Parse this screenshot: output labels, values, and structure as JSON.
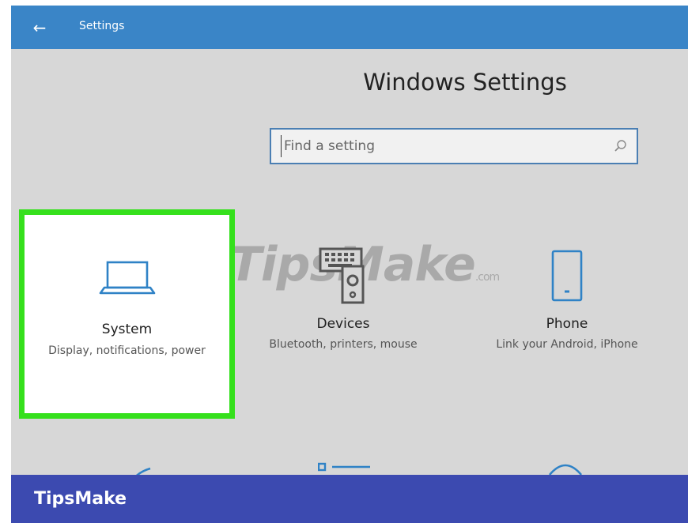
{
  "window": {
    "back_symbol": "←",
    "title": "Settings"
  },
  "heading": "Windows Settings",
  "search": {
    "placeholder": "Find a setting",
    "value": ""
  },
  "tiles": [
    {
      "name": "System",
      "description": "Display, notifications, power",
      "icon": "laptop-icon",
      "highlighted": true
    },
    {
      "name": "Devices",
      "description": "Bluetooth, printers, mouse",
      "icon": "devices-icon"
    },
    {
      "name": "Phone",
      "description": "Link your Android, iPhone",
      "icon": "phone-icon"
    }
  ],
  "watermark": {
    "text": "TipsMake",
    "suffix": ".com"
  },
  "banner": {
    "brand": "TipsMake"
  },
  "colors": {
    "titlebar": "#3a85c7",
    "accent_icon": "#2f82c6",
    "highlight": "#35e01c",
    "banner": "#3c4ab0"
  }
}
